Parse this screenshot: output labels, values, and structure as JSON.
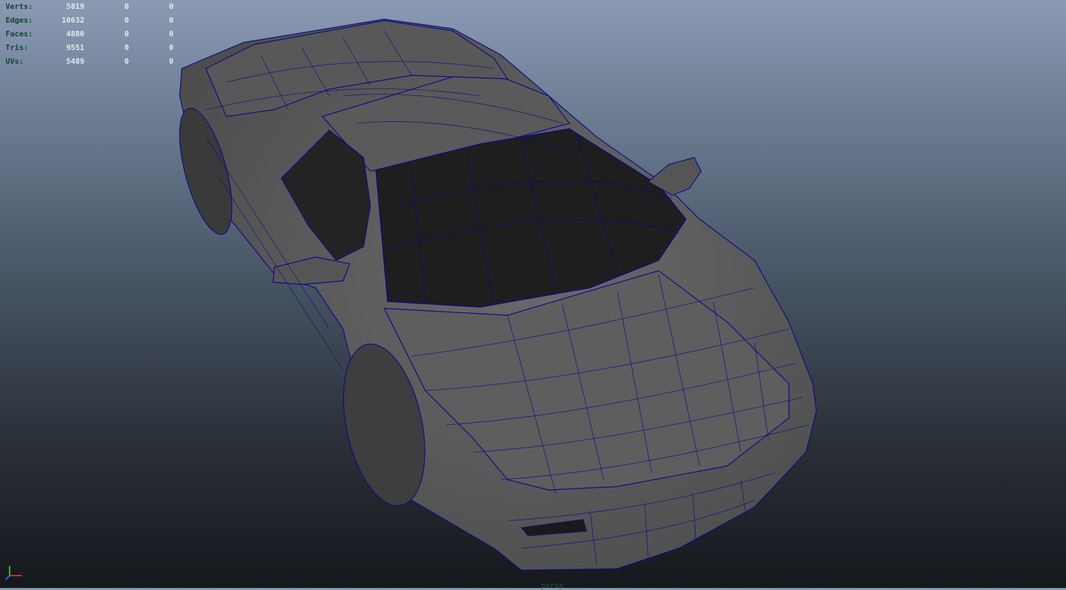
{
  "hud": {
    "rows": [
      {
        "label": "Verts:",
        "v1": "5819",
        "v2": "0",
        "v3": "0"
      },
      {
        "label": "Edges:",
        "v1": "10632",
        "v2": "0",
        "v3": "0"
      },
      {
        "label": "Faces:",
        "v1": "4880",
        "v2": "0",
        "v3": "0"
      },
      {
        "label": "Tris:",
        "v1": "9551",
        "v2": "0",
        "v3": "0"
      },
      {
        "label": "UVs:",
        "v1": "5489",
        "v2": "0",
        "v3": "0"
      }
    ]
  },
  "camera": {
    "label": "persp"
  },
  "colors": {
    "wireframe": "#0a0a8c",
    "body": "#5c5c5c",
    "glass": "#1e1e1e",
    "hud_label": "#0d4a2c"
  },
  "icons": {
    "axis": "xyz-axis-gizmo-icon"
  }
}
